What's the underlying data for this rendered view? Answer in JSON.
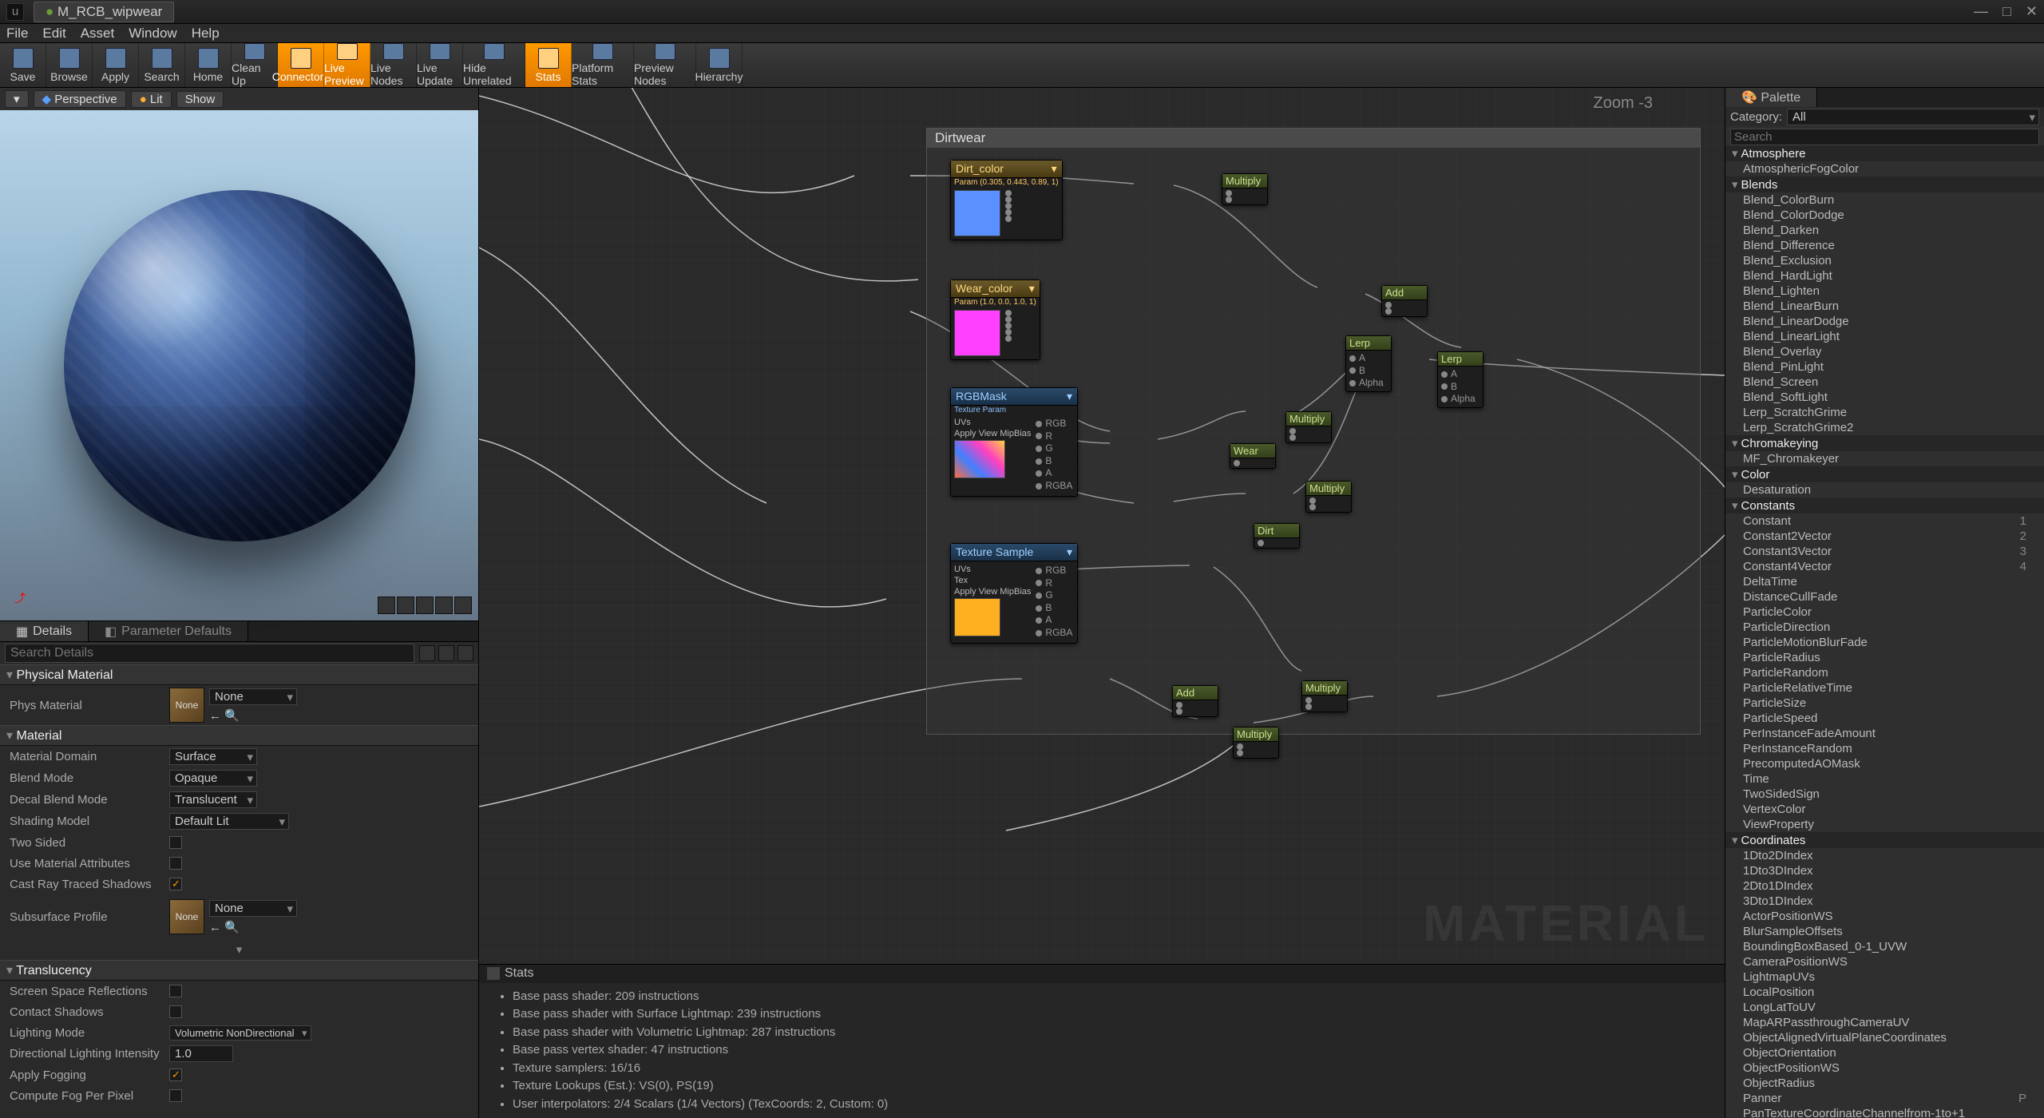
{
  "title_tab": "M_RCB_wipwear",
  "menubar": [
    "File",
    "Edit",
    "Asset",
    "Window",
    "Help"
  ],
  "toolbar": [
    {
      "label": "Save",
      "active": false
    },
    {
      "label": "Browse",
      "active": false
    },
    {
      "label": "Apply",
      "active": false
    },
    {
      "label": "Search",
      "active": false
    },
    {
      "label": "Home",
      "active": false
    },
    {
      "label": "Clean Up",
      "active": false
    },
    {
      "label": "Connectors",
      "active": true
    },
    {
      "label": "Live Preview",
      "active": true
    },
    {
      "label": "Live Nodes",
      "active": false
    },
    {
      "label": "Live Update",
      "active": false
    },
    {
      "label": "Hide Unrelated",
      "active": false,
      "wide": true
    },
    {
      "label": "Stats",
      "active": true
    },
    {
      "label": "Platform Stats",
      "active": false,
      "wide": true
    },
    {
      "label": "Preview Nodes",
      "active": false,
      "wide": true
    },
    {
      "label": "Hierarchy",
      "active": false
    }
  ],
  "viewport_buttons": {
    "perspective": "Perspective",
    "lit": "Lit",
    "show": "Show"
  },
  "tabs": {
    "details": "Details",
    "param_defaults": "Parameter Defaults"
  },
  "search_placeholder": "Search Details",
  "sections": {
    "physmat": {
      "title": "Physical Material",
      "phys_label": "Phys Material",
      "phys_value": "None",
      "dropdown": "None"
    },
    "material": {
      "title": "Material",
      "domain_label": "Material Domain",
      "domain_value": "Surface",
      "blend_label": "Blend Mode",
      "blend_value": "Opaque",
      "decal_label": "Decal Blend Mode",
      "decal_value": "Translucent",
      "shading_label": "Shading Model",
      "shading_value": "Default Lit",
      "twosided_label": "Two Sided",
      "twosided": false,
      "usemat_label": "Use Material Attributes",
      "usemat": false,
      "castray_label": "Cast Ray Traced Shadows",
      "castray": true,
      "subsurf_label": "Subsurface Profile",
      "subsurf_value": "None",
      "subsurf_drop": "None"
    },
    "translucency": {
      "title": "Translucency",
      "ssr_label": "Screen Space Reflections",
      "ssr": false,
      "cshadows_label": "Contact Shadows",
      "cshadows": false,
      "lmode_label": "Lighting Mode",
      "lmode_value": "Volumetric NonDirectional",
      "dli_label": "Directional Lighting Intensity",
      "dli_value": "1.0",
      "fog_label": "Apply Fogging",
      "fog": true,
      "cfpp_label": "Compute Fog Per Pixel",
      "cfpp": false
    }
  },
  "graph": {
    "comment_title": "Dirtwear",
    "zoom_label": "Zoom -3",
    "watermark": "MATERIAL",
    "nodes": {
      "dirt_color": {
        "title": "Dirt_color",
        "sub": "Param (0.305, 0.443, 0.89, 1)"
      },
      "wear_color": {
        "title": "Wear_color",
        "sub": "Param (1.0, 0.0, 1.0, 1)"
      },
      "rgbmask": {
        "title": "RGBMask",
        "sub": "Texture Param",
        "pins": [
          "UVs",
          "Apply View MipBias",
          "RGB",
          "R",
          "G",
          "B",
          "A",
          "RGBA"
        ]
      },
      "texsample": {
        "title": "Texture Sample",
        "pins": [
          "UVs",
          "Tex",
          "Apply View MipBias",
          "RGB",
          "R",
          "G",
          "B",
          "A",
          "RGBA"
        ]
      },
      "multiply": "Multiply",
      "add": "Add",
      "lerp": "Lerp",
      "lerp_alpha": "Alpha",
      "lerp_a": "A",
      "lerp_b": "B",
      "wear": "Wear",
      "dirt": "Dirt"
    }
  },
  "stats": {
    "tab": "Stats",
    "lines": [
      "Base pass shader: 209 instructions",
      "Base pass shader with Surface Lightmap: 239 instructions",
      "Base pass shader with Volumetric Lightmap: 287 instructions",
      "Base pass vertex shader: 47 instructions",
      "Texture samplers: 16/16",
      "Texture Lookups (Est.): VS(0), PS(19)",
      "User interpolators: 2/4 Scalars (1/4 Vectors) (TexCoords: 2, Custom: 0)"
    ]
  },
  "palette": {
    "tab": "Palette",
    "category_label": "Category:",
    "category_value": "All",
    "search_placeholder": "Search",
    "groups": [
      {
        "name": "Atmosphere",
        "items": [
          {
            "n": "AtmosphericFogColor"
          }
        ]
      },
      {
        "name": "Blends",
        "items": [
          {
            "n": "Blend_ColorBurn"
          },
          {
            "n": "Blend_ColorDodge"
          },
          {
            "n": "Blend_Darken"
          },
          {
            "n": "Blend_Difference"
          },
          {
            "n": "Blend_Exclusion"
          },
          {
            "n": "Blend_HardLight"
          },
          {
            "n": "Blend_Lighten"
          },
          {
            "n": "Blend_LinearBurn"
          },
          {
            "n": "Blend_LinearDodge"
          },
          {
            "n": "Blend_LinearLight"
          },
          {
            "n": "Blend_Overlay"
          },
          {
            "n": "Blend_PinLight"
          },
          {
            "n": "Blend_Screen"
          },
          {
            "n": "Blend_SoftLight"
          },
          {
            "n": "Lerp_ScratchGrime"
          },
          {
            "n": "Lerp_ScratchGrime2"
          }
        ]
      },
      {
        "name": "Chromakeying",
        "items": [
          {
            "n": "MF_Chromakeyer"
          }
        ]
      },
      {
        "name": "Color",
        "items": [
          {
            "n": "Desaturation"
          }
        ]
      },
      {
        "name": "Constants",
        "items": [
          {
            "n": "Constant",
            "s": "1"
          },
          {
            "n": "Constant2Vector",
            "s": "2"
          },
          {
            "n": "Constant3Vector",
            "s": "3"
          },
          {
            "n": "Constant4Vector",
            "s": "4"
          },
          {
            "n": "DeltaTime"
          },
          {
            "n": "DistanceCullFade"
          },
          {
            "n": "ParticleColor"
          },
          {
            "n": "ParticleDirection"
          },
          {
            "n": "ParticleMotionBlurFade"
          },
          {
            "n": "ParticleRadius"
          },
          {
            "n": "ParticleRandom"
          },
          {
            "n": "ParticleRelativeTime"
          },
          {
            "n": "ParticleSize"
          },
          {
            "n": "ParticleSpeed"
          },
          {
            "n": "PerInstanceFadeAmount"
          },
          {
            "n": "PerInstanceRandom"
          },
          {
            "n": "PrecomputedAOMask"
          },
          {
            "n": "Time"
          },
          {
            "n": "TwoSidedSign"
          },
          {
            "n": "VertexColor"
          },
          {
            "n": "ViewProperty"
          }
        ]
      },
      {
        "name": "Coordinates",
        "items": [
          {
            "n": "1Dto2DIndex"
          },
          {
            "n": "1Dto3DIndex"
          },
          {
            "n": "2Dto1DIndex"
          },
          {
            "n": "3Dto1DIndex"
          },
          {
            "n": "ActorPositionWS"
          },
          {
            "n": "BlurSampleOffsets"
          },
          {
            "n": "BoundingBoxBased_0-1_UVW"
          },
          {
            "n": "CameraPositionWS"
          },
          {
            "n": "LightmapUVs"
          },
          {
            "n": "LocalPosition"
          },
          {
            "n": "LongLatToUV"
          },
          {
            "n": "MapARPassthroughCameraUV"
          },
          {
            "n": "ObjectAlignedVirtualPlaneCoordinates"
          },
          {
            "n": "ObjectOrientation"
          },
          {
            "n": "ObjectPositionWS"
          },
          {
            "n": "ObjectRadius"
          },
          {
            "n": "Panner",
            "s": "P"
          },
          {
            "n": "PanTextureCoordinateChannelfrom-1to+1"
          }
        ]
      }
    ]
  }
}
